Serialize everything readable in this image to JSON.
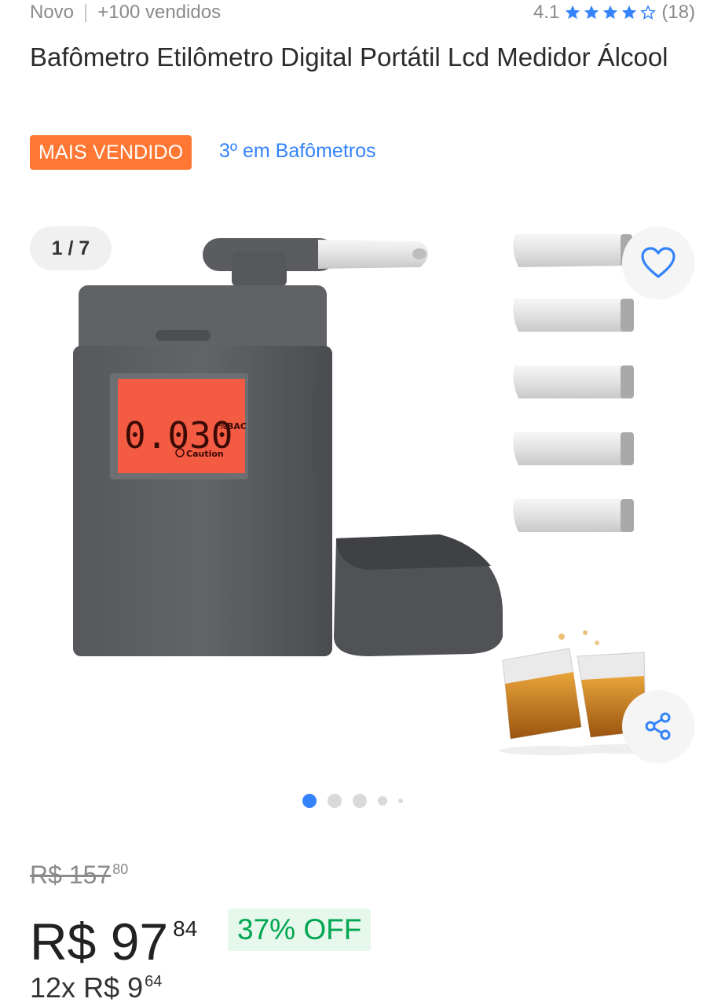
{
  "meta": {
    "condition": "Novo",
    "sold": "+100 vendidos",
    "rating": "4.1",
    "reviews": "(18)",
    "stars_filled": 4,
    "star_color": "#3483fa"
  },
  "product": {
    "title": "Bafômetro Etilômetro Digital Portátil Lcd Medidor Álcool",
    "badge": "MAIS VENDIDO",
    "rank": "3º em Bafômetros"
  },
  "gallery": {
    "counter": "1 / 7",
    "lcd_reading": "0.030",
    "lcd_unit": "%BAC",
    "lcd_caution": "Caution",
    "favorite_icon": "heart-icon",
    "share_icon": "share-icon",
    "active_dot": 1,
    "dot_count": 5
  },
  "price": {
    "currency": "R$",
    "old_int": "157",
    "old_cents": "80",
    "current_int": "97",
    "current_cents": "84",
    "discount": "37% OFF",
    "installments_prefix": "12x",
    "installment_int": "9",
    "installment_cents": "64"
  },
  "colors": {
    "accent": "#3483fa",
    "badge_bg": "#ff7733",
    "discount_green": "#00a650"
  }
}
